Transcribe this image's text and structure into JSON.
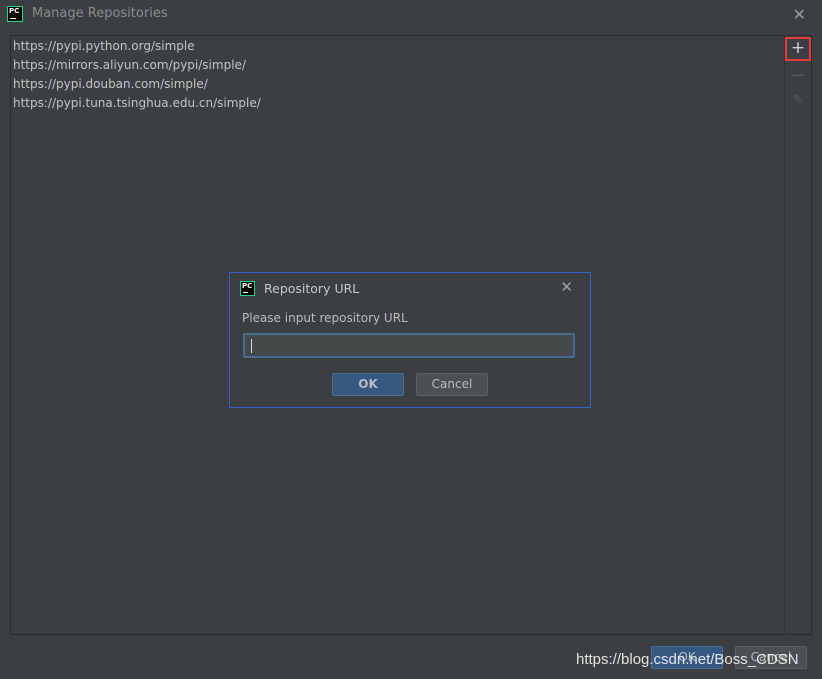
{
  "window": {
    "title": "Manage Repositories",
    "close_glyph": "✕"
  },
  "repositories": [
    "https://pypi.python.org/simple",
    "https://mirrors.aliyun.com/pypi/simple/",
    "https://pypi.douban.com/simple/",
    "https://pypi.tuna.tsinghua.edu.cn/simple/"
  ],
  "toolbar": {
    "add_glyph": "+",
    "remove_glyph": "−",
    "edit_glyph": "✎",
    "highlight_color": "#e23d3d"
  },
  "dialog": {
    "title": "Repository URL",
    "close_glyph": "✕",
    "prompt": "Please input repository URL",
    "input_value": "",
    "ok_label": "OK",
    "cancel_label": "Cancel",
    "border_color": "#2f65ca"
  },
  "footer": {
    "ok_label": "OK",
    "cancel_label": "Cancel"
  },
  "app_logo": {
    "text": "PC"
  },
  "watermark": "https://blog.csdn.net/Boss_CDSN"
}
